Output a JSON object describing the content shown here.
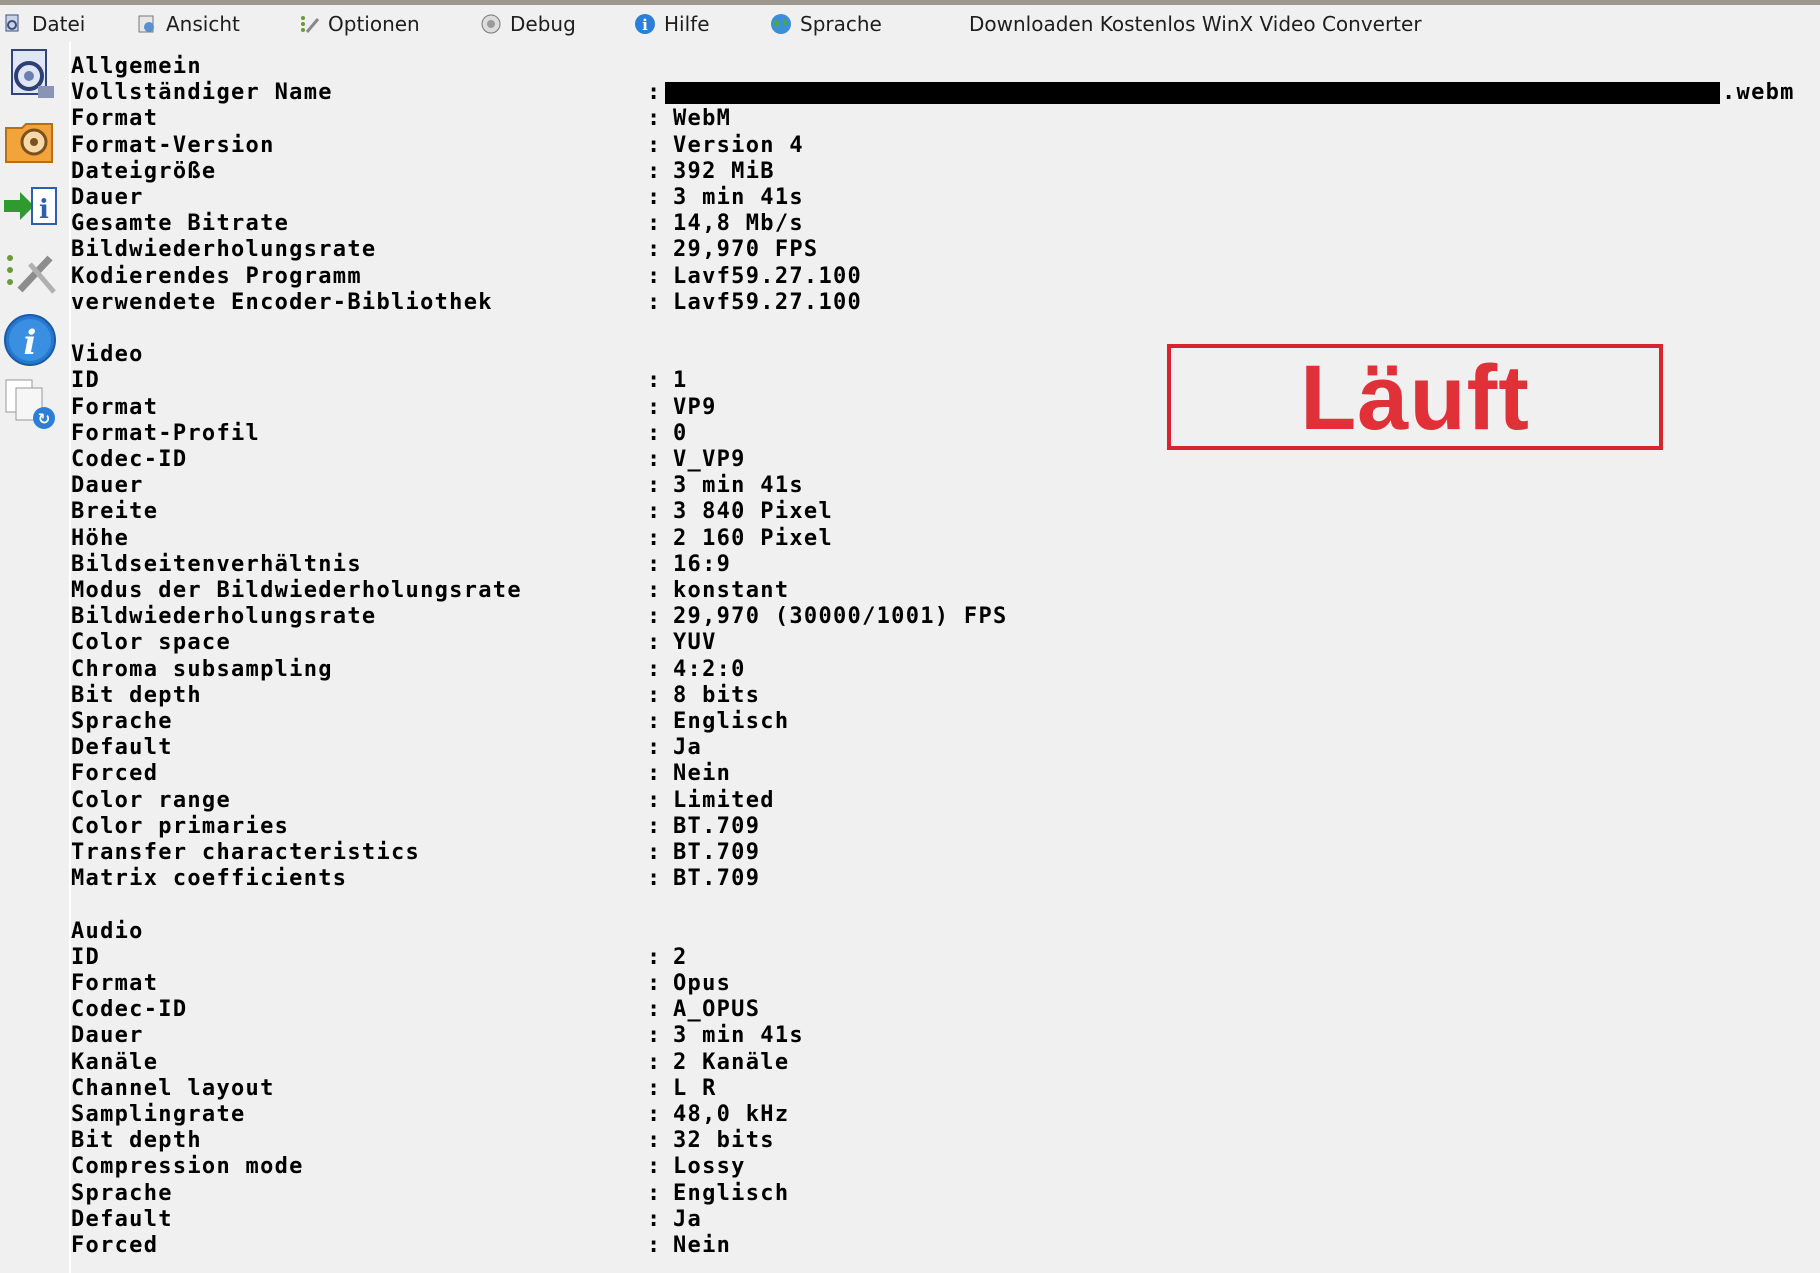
{
  "menu": {
    "datei": "Datei",
    "ansicht": "Ansicht",
    "optionen": "Optionen",
    "debug": "Debug",
    "hilfe": "Hilfe",
    "sprache": "Sprache",
    "download_link": "Downloaden Kostenlos WinX Video Converter"
  },
  "general": {
    "heading": "Allgemein",
    "rows": [
      {
        "label": "Vollständiger Name",
        "value": ".webm"
      },
      {
        "label": "Format",
        "value": "WebM"
      },
      {
        "label": "Format-Version",
        "value": "Version 4"
      },
      {
        "label": "Dateigröße",
        "value": "392 MiB"
      },
      {
        "label": "Dauer",
        "value": "3 min 41s"
      },
      {
        "label": "Gesamte Bitrate",
        "value": "14,8 Mb/s"
      },
      {
        "label": "Bildwiederholungsrate",
        "value": "29,970 FPS"
      },
      {
        "label": "Kodierendes Programm",
        "value": "Lavf59.27.100"
      },
      {
        "label": "verwendete Encoder-Bibliothek",
        "value": "Lavf59.27.100"
      }
    ]
  },
  "video": {
    "heading": "Video",
    "rows": [
      {
        "label": "ID",
        "value": "1"
      },
      {
        "label": "Format",
        "value": "VP9"
      },
      {
        "label": "Format-Profil",
        "value": "0"
      },
      {
        "label": "Codec-ID",
        "value": "V_VP9"
      },
      {
        "label": "Dauer",
        "value": "3 min 41s"
      },
      {
        "label": "Breite",
        "value": "3 840 Pixel"
      },
      {
        "label": "Höhe",
        "value": "2 160 Pixel"
      },
      {
        "label": "Bildseitenverhältnis",
        "value": "16:9"
      },
      {
        "label": "Modus der Bildwiederholungsrate",
        "value": "konstant"
      },
      {
        "label": "Bildwiederholungsrate",
        "value": "29,970 (30000/1001) FPS"
      },
      {
        "label": "Color space",
        "value": "YUV"
      },
      {
        "label": "Chroma subsampling",
        "value": "4:2:0"
      },
      {
        "label": "Bit depth",
        "value": "8 bits"
      },
      {
        "label": "Sprache",
        "value": "Englisch"
      },
      {
        "label": "Default",
        "value": "Ja"
      },
      {
        "label": "Forced",
        "value": "Nein"
      },
      {
        "label": "Color range",
        "value": "Limited"
      },
      {
        "label": "Color primaries",
        "value": "BT.709"
      },
      {
        "label": "Transfer characteristics",
        "value": "BT.709"
      },
      {
        "label": "Matrix coefficients",
        "value": "BT.709"
      }
    ]
  },
  "audio": {
    "heading": "Audio",
    "rows": [
      {
        "label": "ID",
        "value": "2"
      },
      {
        "label": "Format",
        "value": "Opus"
      },
      {
        "label": "Codec-ID",
        "value": "A_OPUS"
      },
      {
        "label": "Dauer",
        "value": "3 min 41s"
      },
      {
        "label": "Kanäle",
        "value": "2 Kanäle"
      },
      {
        "label": "Channel layout",
        "value": "L R"
      },
      {
        "label": "Samplingrate",
        "value": "48,0 kHz"
      },
      {
        "label": "Bit depth",
        "value": "32 bits"
      },
      {
        "label": "Compression mode",
        "value": "Lossy"
      },
      {
        "label": "Sprache",
        "value": "Englisch"
      },
      {
        "label": "Default",
        "value": "Ja"
      },
      {
        "label": "Forced",
        "value": "Nein"
      }
    ]
  },
  "separator": ":",
  "stamp": {
    "text": "Läuft",
    "color": "#e03139"
  },
  "toolbar_icons": [
    "open-file-icon",
    "open-folder-icon",
    "export-icon",
    "preferences-icon",
    "about-icon",
    "info-pages-icon"
  ]
}
